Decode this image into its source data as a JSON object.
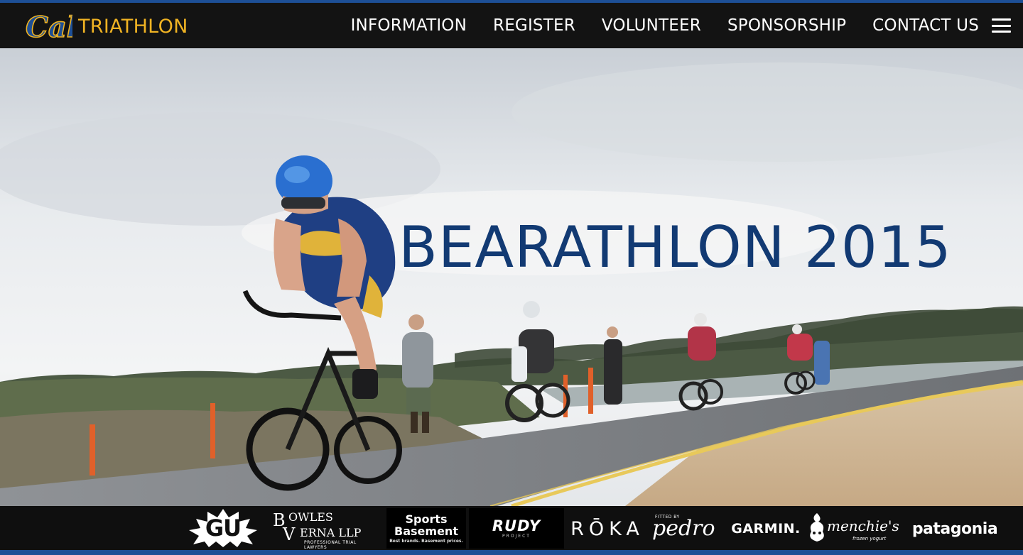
{
  "header": {
    "logo_text": "Cal",
    "brand_title": "TRIATHLON",
    "nav": [
      {
        "label": "INFORMATION"
      },
      {
        "label": "REGISTER"
      },
      {
        "label": "VOLUNTEER"
      },
      {
        "label": "SPONSORSHIP"
      },
      {
        "label": "CONTACT US"
      }
    ],
    "menu_icon": "hamburger-menu-icon"
  },
  "hero": {
    "title": "BEARATHLON 2015",
    "image": "triathlon-cyclists-road-photo"
  },
  "sponsors": [
    {
      "name": "GU"
    },
    {
      "name_top": "B",
      "name_top_rest": "OWLES",
      "name_bottom": "V",
      "name_bottom_rest": "ERNA LLP",
      "tagline": "PROFESSIONAL TRIAL LAWYERS"
    },
    {
      "line1": "Sports",
      "line2": "Basement",
      "tagline": "Best brands. Basement prices."
    },
    {
      "name": "RUDY",
      "tagline": "PROJECT"
    },
    {
      "name": "RŌKA"
    },
    {
      "prefix": "FITTED BY",
      "name": "pedro"
    },
    {
      "name": "GARMIN."
    },
    {
      "name": "menchie's",
      "tagline": "frozen yogurt"
    },
    {
      "name": "patagonia"
    }
  ],
  "colors": {
    "nav_background": "#131313",
    "brand_gold": "#f0b323",
    "cal_blue": "#1d4f96",
    "hero_title": "#123a73"
  }
}
